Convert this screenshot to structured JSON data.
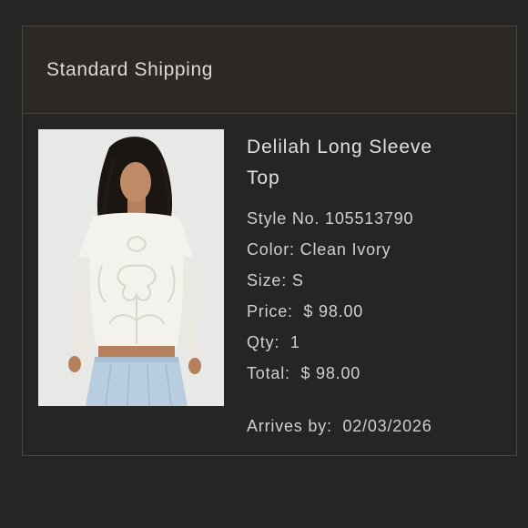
{
  "shipping": {
    "title": "Standard Shipping"
  },
  "product": {
    "name_line1": "Delilah Long Sleeve",
    "name_line2": "Top",
    "image_label": "product-photo-woman-in-ivory-long-sleeve-lace-top",
    "style": {
      "label": "Style No.",
      "value": "105513790"
    },
    "color": {
      "label": "Color:",
      "value": "Clean Ivory"
    },
    "size": {
      "label": "Size:",
      "value": "S"
    },
    "price": {
      "label": "Price:",
      "value": "$ 98.00"
    },
    "qty": {
      "label": "Qty:",
      "value": "1"
    },
    "total": {
      "label": "Total:",
      "value": "$ 98.00"
    },
    "arrives": {
      "label": "Arrives by:",
      "value": "02/03/2026"
    }
  },
  "colors": {
    "page_bg": "#262524",
    "header_bg": "#2c2924",
    "border": "#4a4744",
    "text": "#d8d6d2"
  }
}
